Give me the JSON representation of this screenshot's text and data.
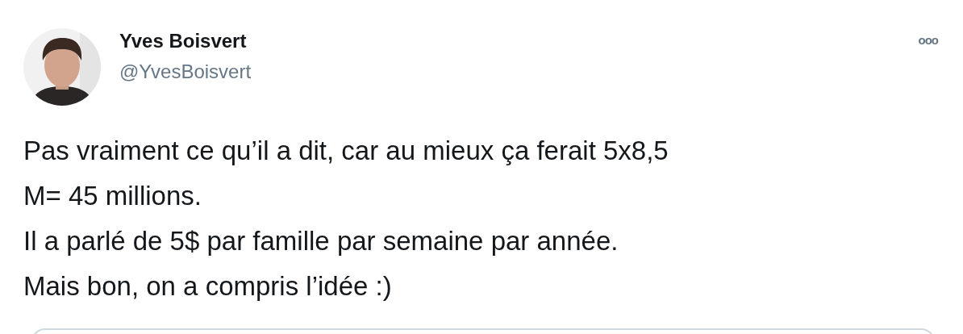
{
  "author": {
    "name": "Yves Boisvert",
    "handle": "@YvesBoisvert"
  },
  "more_menu": {
    "glyph": "ooo"
  },
  "tweet_text": "Pas vraiment ce qu’il a dit, car au mieux ça ferait 5x8,5\nM= 45 millions.\nIl a parlé de 5$ par famille par semaine par année.\nMais bon, on a compris l’idée :)",
  "quoted_card": {
    "kind": "card"
  }
}
